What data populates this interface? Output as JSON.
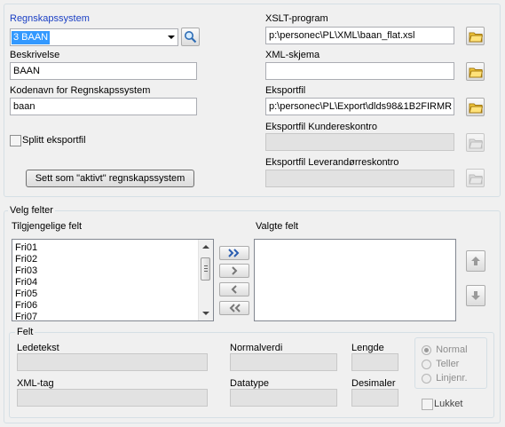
{
  "system": {
    "regnskapssystem_label": "Regnskapssystem",
    "regnskapssystem_value": "3 BAAN",
    "beskrivelse_label": "Beskrivelse",
    "beskrivelse_value": "BAAN",
    "kodenavn_label": "Kodenavn for Regnskapssystem",
    "kodenavn_value": "baan",
    "splitt_label": "Splitt eksportfil",
    "set_active_label": "Sett som \"aktivt\" regnskapssystem",
    "xslt_label": "XSLT-program",
    "xslt_value": "p:\\personec\\PL\\XML\\baan_flat.xsl",
    "xml_skjema_label": "XML-skjema",
    "xml_skjema_value": "",
    "eksportfil_label": "Eksportfil",
    "eksportfil_value": "p:\\personec\\PL\\Export\\dlds98&1B2FIRMR",
    "kunde_label": "Eksportfil Kundereskontro",
    "leverandor_label": "Eksportfil Leverandørreskontro"
  },
  "velg_felter": {
    "title": "Velg felter",
    "available_label": "Tilgjengelige felt",
    "selected_label": "Valgte felt",
    "available_items": [
      "Fri01",
      "Fri02",
      "Fri03",
      "Fri04",
      "Fri05",
      "Fri06",
      "Fri07"
    ],
    "felt": {
      "title": "Felt",
      "ledetekst_label": "Ledetekst",
      "normalverdi_label": "Normalverdi",
      "lengde_label": "Lengde",
      "xmltag_label": "XML-tag",
      "datatype_label": "Datatype",
      "desimaler_label": "Desimaler",
      "radio_normal": "Normal",
      "radio_teller": "Teller",
      "radio_linjenr": "Linjenr.",
      "lukket_label": "Lukket"
    }
  }
}
